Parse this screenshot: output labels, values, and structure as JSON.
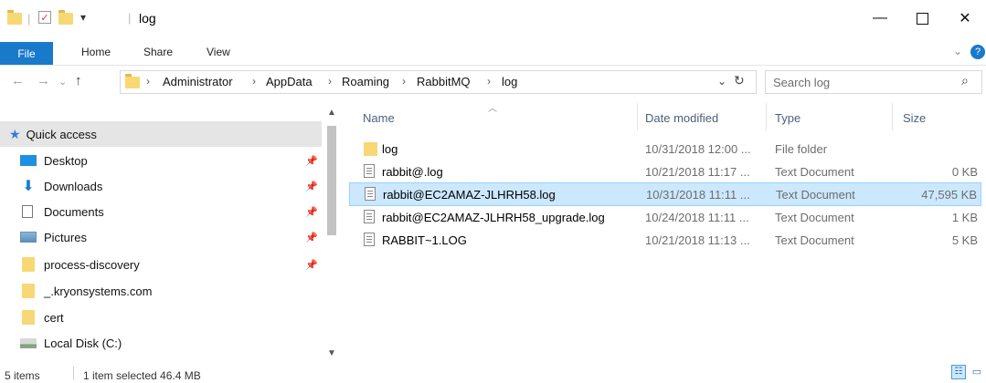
{
  "window": {
    "title": "log",
    "minimize_icon": "minimize-icon",
    "maximize_icon": "maximize-icon",
    "close_icon": "close-icon"
  },
  "ribbon": {
    "tabs": [
      "File",
      "Home",
      "Share",
      "View"
    ]
  },
  "address": {
    "crumbs": [
      "Administrator",
      "AppData",
      "Roaming",
      "RabbitMQ",
      "log"
    ],
    "search_placeholder": "Search log"
  },
  "nav": {
    "items": [
      {
        "label": "Quick access",
        "icon": "star-icon",
        "pinned": false
      },
      {
        "label": "Desktop",
        "icon": "desktop-icon",
        "pinned": true
      },
      {
        "label": "Downloads",
        "icon": "download-icon",
        "pinned": true
      },
      {
        "label": "Documents",
        "icon": "documents-icon",
        "pinned": true
      },
      {
        "label": "Pictures",
        "icon": "pictures-icon",
        "pinned": true
      },
      {
        "label": "process-discovery",
        "icon": "folder-icon",
        "pinned": true
      },
      {
        "label": "_.kryonsystems.com",
        "icon": "folder-icon",
        "pinned": false
      },
      {
        "label": "cert",
        "icon": "folder-icon",
        "pinned": false
      },
      {
        "label": "Local Disk (C:)",
        "icon": "drive-icon",
        "pinned": false
      }
    ]
  },
  "files": {
    "columns": [
      "Name",
      "Date modified",
      "Type",
      "Size"
    ],
    "rows": [
      {
        "name": "log",
        "date": "10/31/2018 12:00 ...",
        "type": "File folder",
        "size": "",
        "icon": "folder-icon"
      },
      {
        "name": "rabbit@.log",
        "date": "10/21/2018 11:17 ...",
        "type": "Text Document",
        "size": "0 KB",
        "icon": "text-file-icon"
      },
      {
        "name": "rabbit@EC2AMAZ-JLHRH58.log",
        "date": "10/31/2018 11:11 ...",
        "type": "Text Document",
        "size": "47,595 KB",
        "icon": "text-file-icon"
      },
      {
        "name": "rabbit@EC2AMAZ-JLHRH58_upgrade.log",
        "date": "10/24/2018 11:11 ...",
        "type": "Text Document",
        "size": "1 KB",
        "icon": "text-file-icon"
      },
      {
        "name": "RABBIT~1.LOG",
        "date": "10/21/2018 11:13 ...",
        "type": "Text Document",
        "size": "5 KB",
        "icon": "text-file-icon"
      }
    ]
  },
  "status": {
    "item_count": "5 items",
    "selection": "1 item selected 46.4 MB"
  },
  "colors": {
    "accent": "#1979ca",
    "selection_bg": "#cce8ff",
    "folder": "#f8d775"
  }
}
